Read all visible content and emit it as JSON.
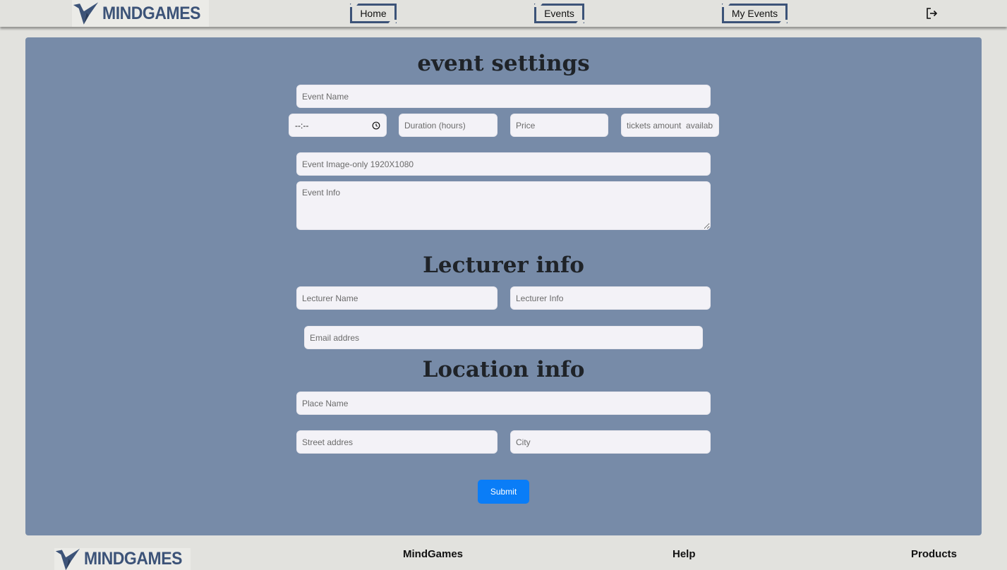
{
  "header": {
    "logo_text": "MINDGAMES",
    "nav": {
      "home": "Home",
      "events": "Events",
      "my_events": "My Events"
    }
  },
  "form": {
    "event_section_title": "event settings",
    "event_name_placeholder": "Event Name",
    "time_value": "--:--",
    "duration_placeholder": "Duration (hours)",
    "price_placeholder": "Price",
    "tickets_placeholder": "tickets amount  available",
    "image_placeholder": "Event Image-only 1920X1080",
    "info_placeholder": "Event Info",
    "lecturer_section_title": "Lecturer info",
    "lecturer_name_placeholder": "Lecturer Name",
    "lecturer_info_placeholder": "Lecturer Info",
    "email_placeholder": "Email addres",
    "location_section_title": "Location info",
    "place_name_placeholder": "Place Name",
    "street_placeholder": "Street addres",
    "city_placeholder": "City",
    "submit_label": "Submit"
  },
  "footer": {
    "logo_text": "MINDGAMES",
    "links": {
      "mindgames": "MindGames",
      "help": "Help",
      "products": "Products"
    }
  },
  "colors": {
    "brand": "#3c5378",
    "panel": "#778ba8",
    "submit": "#0a7df7",
    "background": "#e2e2de"
  }
}
